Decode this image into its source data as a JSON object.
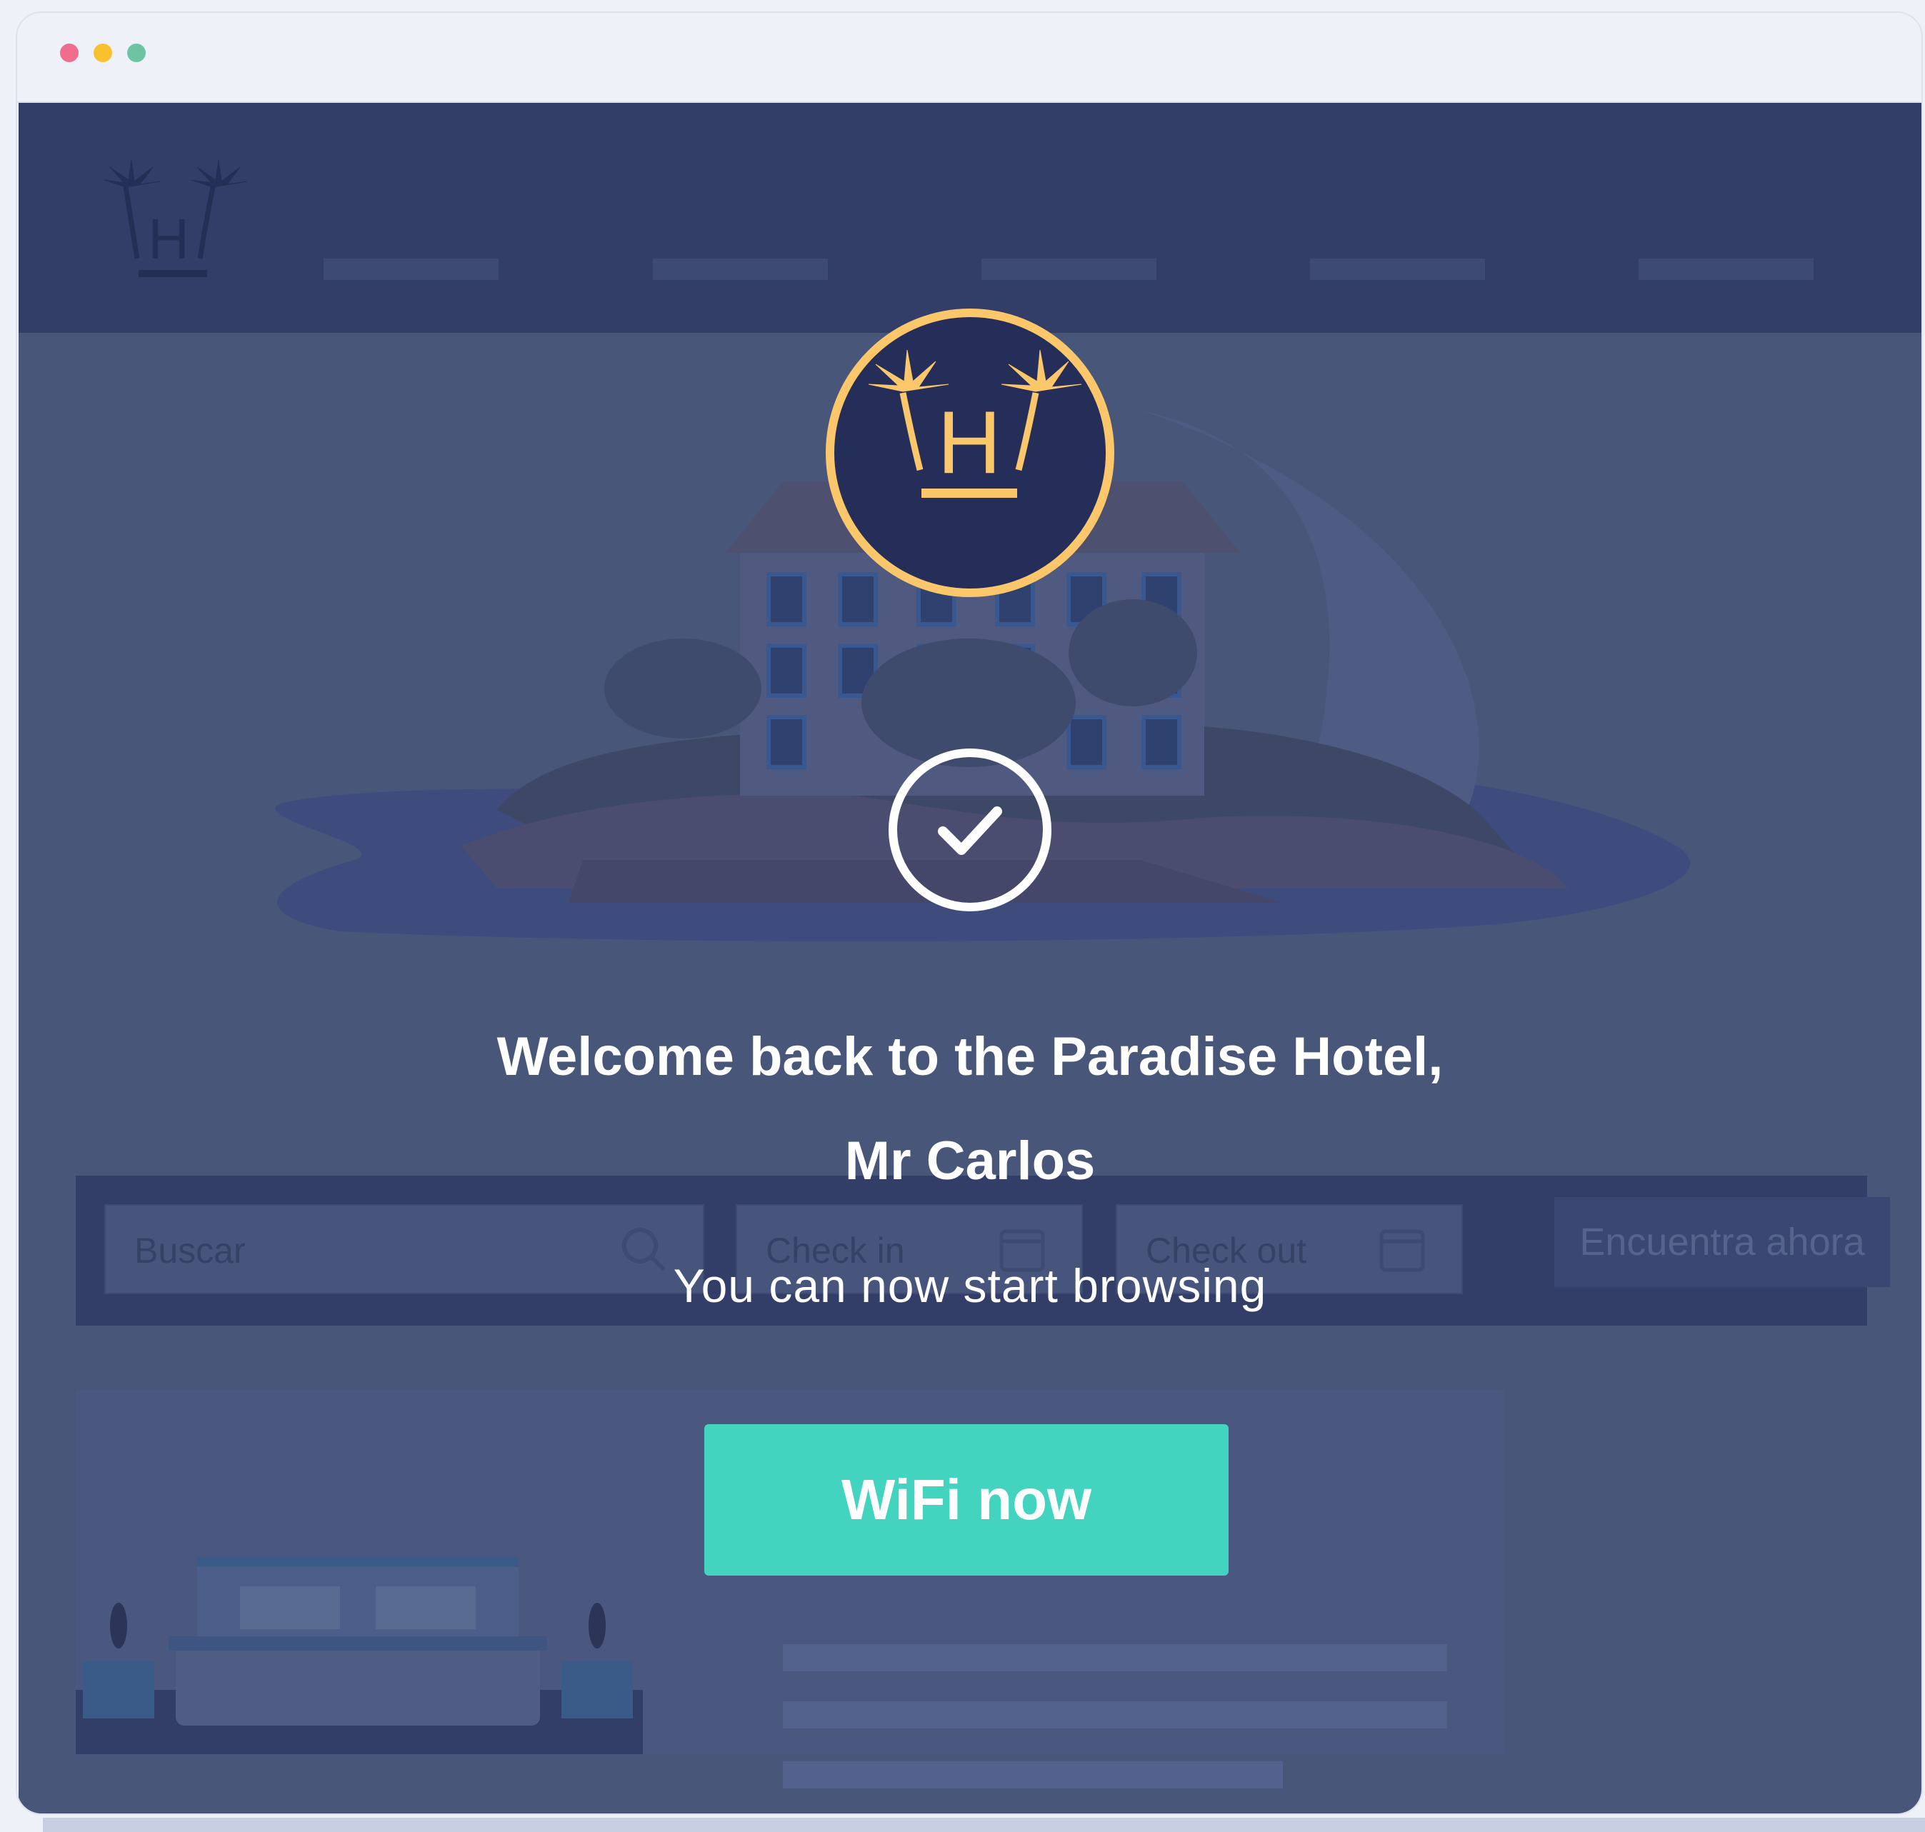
{
  "window": {
    "controls": [
      "close-dot",
      "minimize-dot",
      "maximize-dot"
    ],
    "colors": {
      "close": "#f06d8e",
      "minimize": "#f7c22e",
      "maximize": "#6dc4a2"
    }
  },
  "site": {
    "search": {
      "destination_placeholder": "Buscar",
      "checkin_placeholder": "Check in",
      "checkout_placeholder": "Check out",
      "submit_label": "Encuentra ahora"
    }
  },
  "overlay": {
    "welcome_line1": "Welcome back to the Paradise Hotel,",
    "welcome_line2": "Mr Carlos",
    "subtitle": "You can now start browsing",
    "cta_label": "WiFi now",
    "colors": {
      "accent": "#42d4bf",
      "badge_ring": "#fbc76a",
      "badge_fill": "#242e59",
      "backdrop": "#48567a"
    }
  }
}
